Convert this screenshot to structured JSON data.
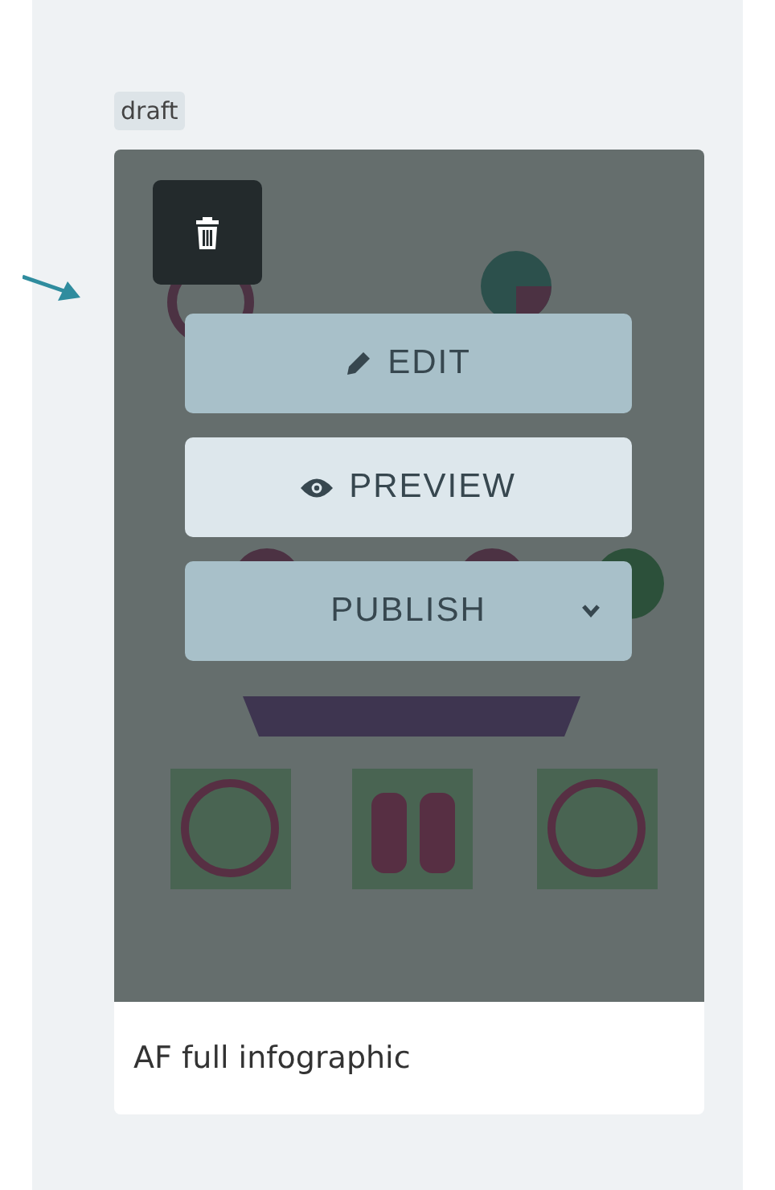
{
  "badge": "draft",
  "card": {
    "title": "AF full infographic"
  },
  "actions": [
    {
      "kind": "edit",
      "label": "EDIT",
      "hovered": false
    },
    {
      "kind": "preview",
      "label": "PREVIEW",
      "hovered": true
    },
    {
      "kind": "publish",
      "label": "PUBLISH",
      "hovered": false
    }
  ]
}
